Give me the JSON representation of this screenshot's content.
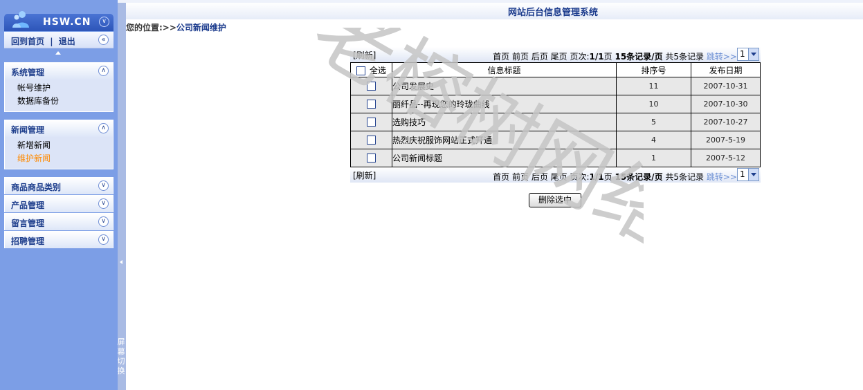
{
  "app": {
    "system_name": "网站后台信息管理系统",
    "brand": "HSW.CN"
  },
  "sidebar": {
    "home_link": "回到首页",
    "separator": "|",
    "logout_link": "退出",
    "groups": [
      {
        "title": "系统管理",
        "items": [
          "帐号维护",
          "数据库备份"
        ],
        "expanded": true
      },
      {
        "title": "新闻管理",
        "items": [
          "新增新闻",
          "维护新闻"
        ],
        "expanded": true,
        "active_item": "维护新闻"
      },
      {
        "title": "商品商品类别",
        "expanded": false
      },
      {
        "title": "产品管理",
        "expanded": false
      },
      {
        "title": "留言管理",
        "expanded": false
      },
      {
        "title": "招聘管理",
        "expanded": false
      }
    ],
    "splitter_text": "屏幕切换"
  },
  "breadcrumb": {
    "prefix": "您的位置:>>",
    "current": "公司新闻维护"
  },
  "pager": {
    "refresh": "[刷新]",
    "first": "首页",
    "prev": "前页",
    "next": "后页",
    "last": "尾页",
    "page_label": "页次:",
    "page_value": "1/1",
    "page_unit": "页",
    "per_page": "15条记录/页",
    "total": "共5条记录",
    "jump": "跳转>>",
    "selected_page": "1"
  },
  "table": {
    "headers": {
      "select_all": "全选",
      "title": "信息标题",
      "order": "排序号",
      "date": "发布日期"
    },
    "rows": [
      {
        "title": "公司发展史",
        "order": "11",
        "date": "2007-10-31"
      },
      {
        "title": "丽纤品--再现您的玲珑曲线",
        "order": "10",
        "date": "2007-10-30"
      },
      {
        "title": "选购技巧",
        "order": "5",
        "date": "2007-10-27"
      },
      {
        "title": "热烈庆祝服饰网站正式开通",
        "order": "4",
        "date": "2007-5-19"
      },
      {
        "title": "公司新闻标题",
        "order": "1",
        "date": "2007-5-12"
      }
    ]
  },
  "actions": {
    "delete_selected": "删除选中"
  },
  "watermark": {
    "text": "老榕树网络",
    "color": "#c4c4c4"
  },
  "colors": {
    "sidebar_bg": "#7c9ee6",
    "accent_text": "#1e3e8c",
    "active_item": "#ff8a00"
  }
}
